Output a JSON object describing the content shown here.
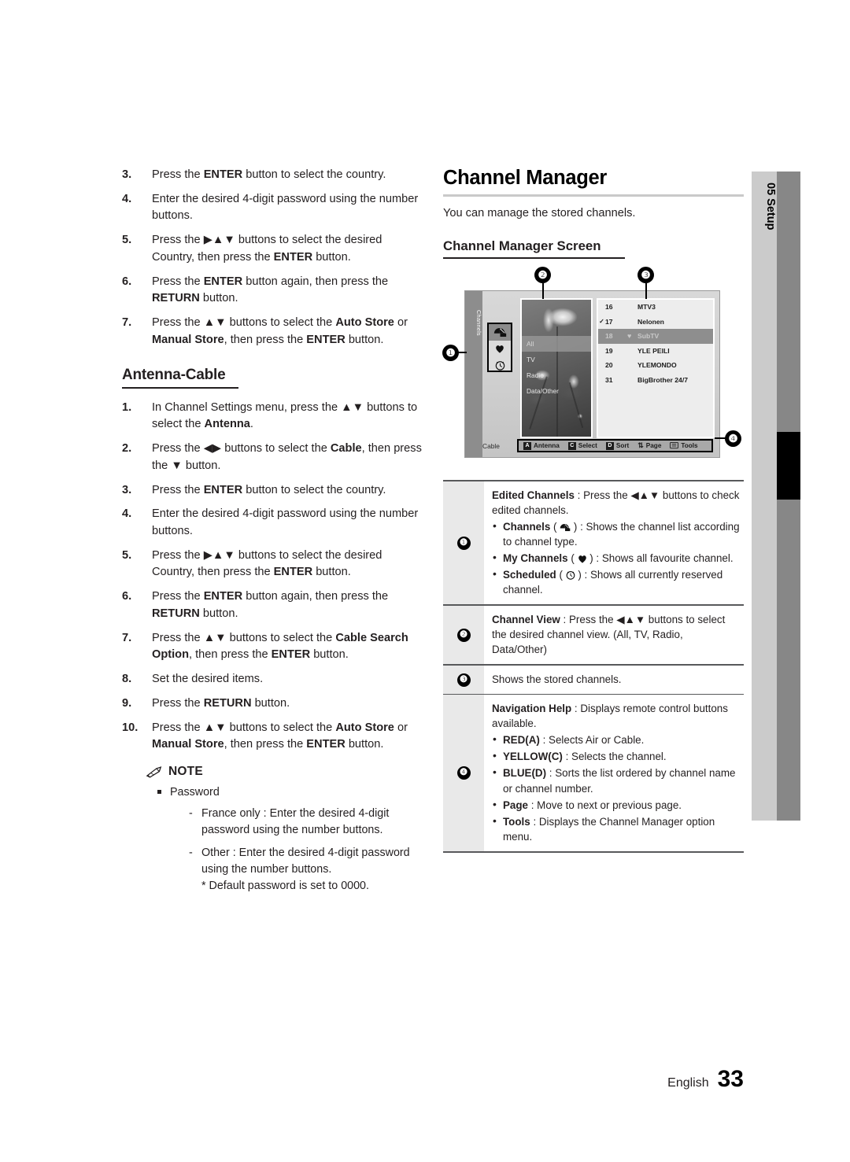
{
  "left_column": {
    "steps_top": [
      {
        "num": "3.",
        "html": "Press the <b>ENTER</b> button to select the country."
      },
      {
        "num": "4.",
        "html": "Enter the desired 4-digit password using the number buttons."
      },
      {
        "num": "5.",
        "html": "Press the ▶▲▼ buttons to select the desired Country, then press the <b>ENTER</b> button."
      },
      {
        "num": "6.",
        "html": "Press the <b>ENTER</b> button again, then press the <b>RETURN</b> button."
      },
      {
        "num": "7.",
        "html": "Press the ▲▼ buttons to select the <b>Auto Store</b> or <b>Manual Store</b>, then press the <b>ENTER</b> button."
      }
    ],
    "section_heading": "Antenna-Cable",
    "steps_bottom": [
      {
        "num": "1.",
        "html": "In Channel Settings menu, press the ▲▼ buttons to select the <b>Antenna</b>."
      },
      {
        "num": "2.",
        "html": "Press the ◀▶ buttons to select the <b>Cable</b>, then press the ▼ button."
      },
      {
        "num": "3.",
        "html": "Press the <b>ENTER</b> button to select the country."
      },
      {
        "num": "4.",
        "html": "Enter the desired 4-digit password using the number buttons."
      },
      {
        "num": "5.",
        "html": "Press the ▶▲▼ buttons to select the desired Country, then press the <b>ENTER</b> button."
      },
      {
        "num": "6.",
        "html": "Press the <b>ENTER</b> button again, then press the <b>RETURN</b> button."
      },
      {
        "num": "7.",
        "html": "Press the ▲▼ buttons to select the <b>Cable Search Option</b>, then press the <b>ENTER</b> button."
      },
      {
        "num": "8.",
        "html": "Set the desired items."
      },
      {
        "num": "9.",
        "html": "Press the <b>RETURN</b> button."
      },
      {
        "num": "10.",
        "html": "Press the ▲▼ buttons to select the <b>Auto Store</b> or <b>Manual Store</b>, then press the <b>ENTER</b> button."
      }
    ],
    "note": {
      "title": "NOTE",
      "icon": "pencil-icon",
      "items": [
        {
          "html": "Password",
          "subs": [
            {
              "html": "France only : Enter the desired 4-digit password using the number buttons."
            },
            {
              "html": "Other : Enter the desired 4-digit password using the number buttons.",
              "extra": "* Default password is set to 0000."
            }
          ]
        }
      ]
    }
  },
  "right_column": {
    "title": "Channel Manager",
    "intro": "You can manage the stored channels.",
    "subtitle": "Channel Manager Screen",
    "callouts": {
      "one": "❶",
      "two": "❷",
      "three": "❸",
      "four": "❹"
    },
    "tv_screen": {
      "side_tab_label": "Channels",
      "rail_icons": [
        {
          "name": "channels-icon",
          "selected": true
        },
        {
          "name": "heart-icon",
          "selected": false
        },
        {
          "name": "clock-icon",
          "selected": false
        }
      ],
      "channel_types": [
        {
          "label": "All",
          "selected": true
        },
        {
          "label": "TV",
          "selected": false
        },
        {
          "label": "Radio",
          "selected": false
        },
        {
          "label": "Data/Other",
          "selected": false
        }
      ],
      "channels": [
        {
          "check": "",
          "num": "16",
          "fav": "",
          "name": "MTV3",
          "selected": false
        },
        {
          "check": "✓",
          "num": "17",
          "fav": "",
          "name": "Nelonen",
          "selected": false
        },
        {
          "check": "",
          "num": "18",
          "fav": "♥",
          "name": "SubTV",
          "selected": true
        },
        {
          "check": "",
          "num": "19",
          "fav": "",
          "name": "YLE PEILI",
          "selected": false
        },
        {
          "check": "",
          "num": "20",
          "fav": "",
          "name": "YLEMONDO",
          "selected": false
        },
        {
          "check": "",
          "num": "31",
          "fav": "",
          "name": "BigBrother 24/7",
          "selected": false
        }
      ],
      "bottom_bar": {
        "source_label": "Cable",
        "items": [
          {
            "key": "A",
            "key_type": "box",
            "label": "Antenna"
          },
          {
            "key": "C",
            "key_type": "box",
            "label": "Select"
          },
          {
            "key": "D",
            "key_type": "box",
            "label": "Sort"
          },
          {
            "key": "⇅",
            "key_type": "glyph",
            "label": "Page"
          },
          {
            "key": "tools-icon",
            "key_type": "icon",
            "label": "Tools"
          }
        ]
      }
    },
    "legend": [
      {
        "badge": "❶",
        "head_bold": "Edited Channels",
        "head_rest": " : Press the ◀▲▼ buttons to check edited channels.",
        "subs": [
          {
            "bold": "Channels",
            "icon": "channels-icon",
            "rest": " : Shows the channel list according to channel type."
          },
          {
            "bold": "My Channels",
            "icon": "heart-icon",
            "rest": " : Shows all favourite channel."
          },
          {
            "bold": "Scheduled",
            "icon": "clock-icon",
            "rest": " : Shows all currently reserved channel."
          }
        ]
      },
      {
        "badge": "❷",
        "head_bold": "Channel View",
        "head_rest": " : Press the ◀▲▼ buttons to select the desired channel view. (All, TV, Radio, Data/Other)",
        "subs": []
      },
      {
        "badge": "❸",
        "head_bold": "",
        "head_rest": "Shows the stored channels.",
        "subs": []
      },
      {
        "badge": "❹",
        "head_bold": "Navigation Help",
        "head_rest": " : Displays remote control buttons available.",
        "subs": [
          {
            "bold": "RED(A)",
            "icon": "",
            "rest": " : Selects Air or Cable."
          },
          {
            "bold": "YELLOW(C)",
            "icon": "",
            "rest": " : Selects the channel."
          },
          {
            "bold": "BLUE(D)",
            "icon": "",
            "rest": " : Sorts the list ordered by channel name or channel number."
          },
          {
            "bold": "Page",
            "icon": "",
            "rest": " : Move to next or previous page."
          },
          {
            "bold": "Tools",
            "icon": "",
            "rest": " : Displays the Channel Manager option menu."
          }
        ]
      }
    ]
  },
  "chapter_tab": {
    "number": "05",
    "label": "Setup",
    "combined": "05  Setup"
  },
  "footer": {
    "language": "English",
    "page": "33"
  }
}
